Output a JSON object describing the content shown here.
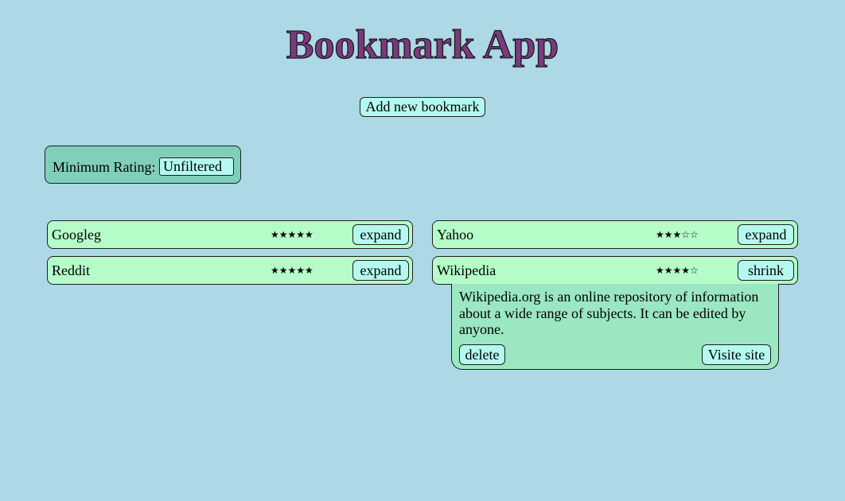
{
  "app": {
    "title": "Bookmark App",
    "add_button_label": "Add new bookmark"
  },
  "filter": {
    "label": "Minimum Rating:",
    "selected": "Unfiltered"
  },
  "bookmarks": [
    {
      "name": "Googleg",
      "stars": "★★★★★",
      "rating": 5,
      "toggle_label": "expand"
    },
    {
      "name": "Yahoo",
      "stars": "★★★☆☆",
      "rating": 3,
      "toggle_label": "expand"
    },
    {
      "name": "Reddit",
      "stars": "★★★★★",
      "rating": 5,
      "toggle_label": "expand"
    },
    {
      "name": "Wikipedia",
      "stars": "★★★★☆",
      "rating": 4,
      "toggle_label": "shrink"
    }
  ],
  "expanded": {
    "description": "Wikipedia.org is an online repository of information about a wide range of subjects. It can be edited by anyone.",
    "delete_label": "delete",
    "visit_label": "Visite site"
  },
  "colors": {
    "background": "#add8e6",
    "title": "#7b3a7f",
    "button": "#b4f9ef",
    "filter_panel": "#7fcfbb",
    "bookmark_row": "#b5fcc8",
    "details_panel": "#9ae7c2"
  }
}
